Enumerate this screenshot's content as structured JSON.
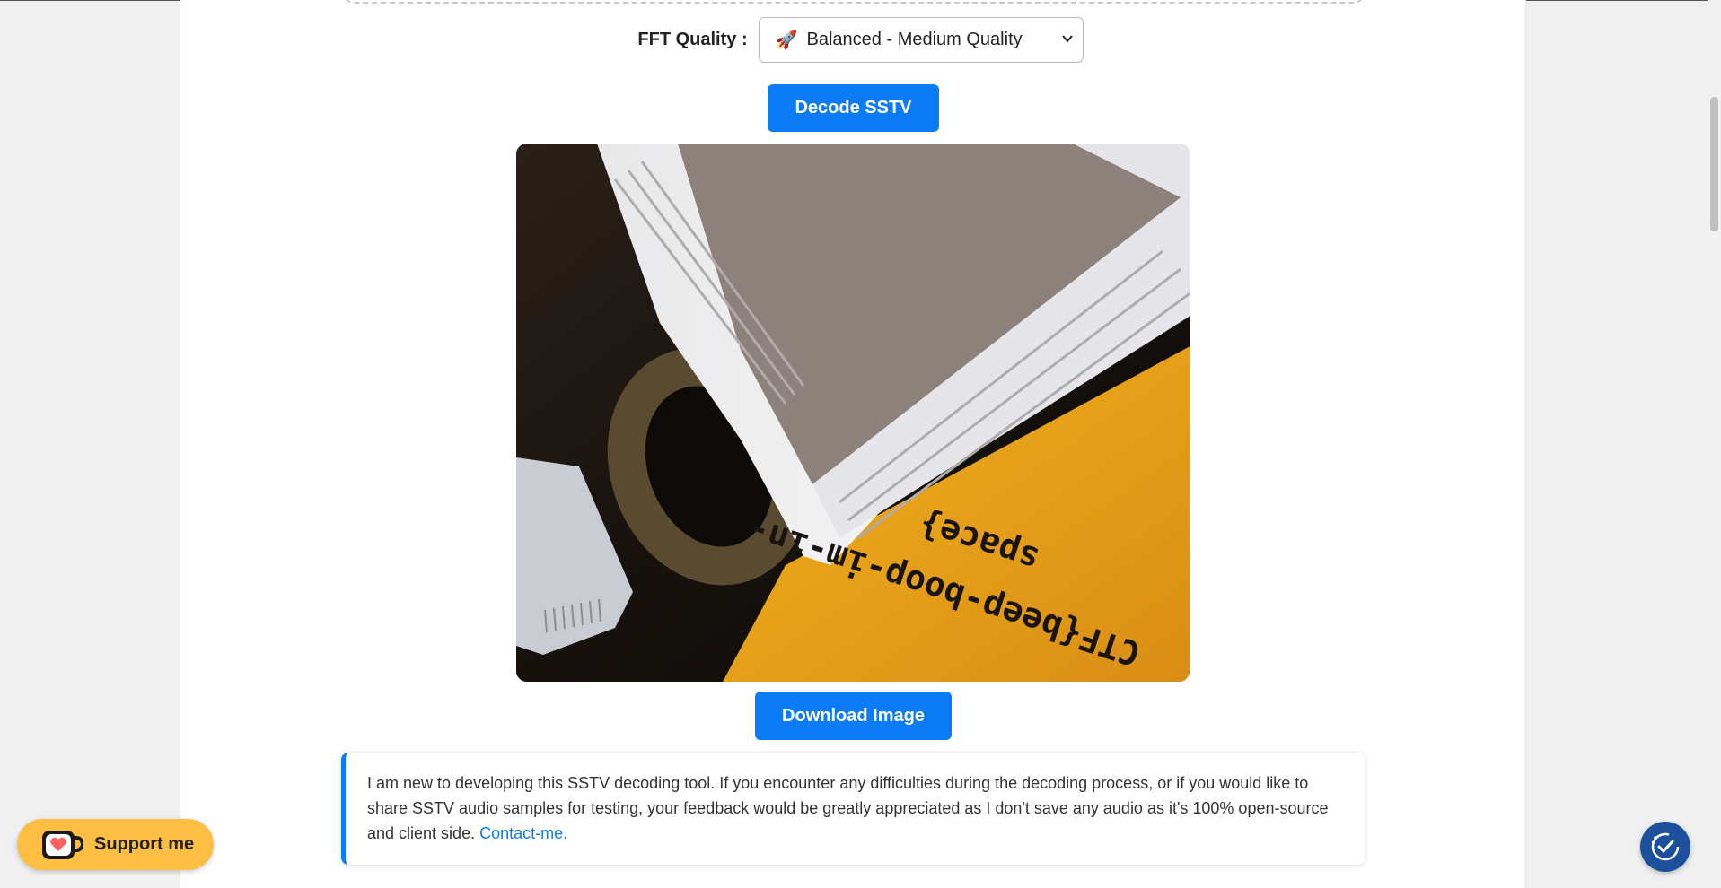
{
  "fft": {
    "label": "FFT Quality :",
    "selected_option": "Balanced - Medium Quality",
    "selected_icon": "🚀"
  },
  "buttons": {
    "decode": "Decode SSTV",
    "download": "Download Image"
  },
  "decoded_image": {
    "visible_text_top": "CTF{beep-boop-im-in-",
    "visible_text_bottom": "space}"
  },
  "note": {
    "text": "I am new to developing this SSTV decoding tool. If you encounter any difficulties during the decoding process, or if you would like to share SSTV audio samples for testing, your feedback would be greatly appreciated as I don't save any audio as it's 100% open-source and client side.",
    "link": "Contact-me."
  },
  "support": {
    "label": "Support me"
  },
  "colors": {
    "accent": "#0b7cf5",
    "support_bg": "#fdbf43",
    "a11y_bg": "#1c4f9c"
  }
}
